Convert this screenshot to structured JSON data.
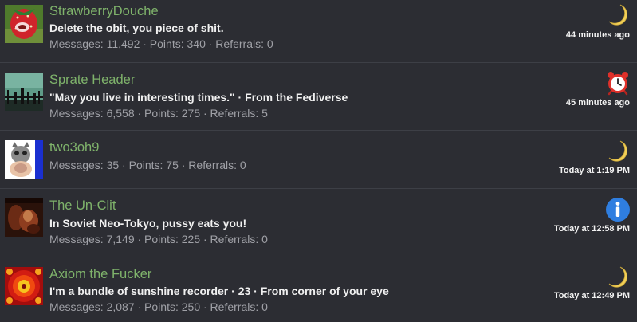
{
  "members": [
    {
      "name": "StrawberryDouche",
      "status": "Delete the obit, you piece of shit.",
      "stats": "Messages: 11,492 · Points: 340 · Referrals: 0",
      "time": "44 minutes ago",
      "icon": "crescent-moon-icon"
    },
    {
      "name": "Sprate Header",
      "status": "\"May you live in interesting times.\" · From the Fediverse",
      "stats": "Messages: 6,558 · Points: 275 · Referrals: 5",
      "time": "45 minutes ago",
      "icon": "alarm-clock-icon"
    },
    {
      "name": "two3oh9",
      "status": "",
      "stats": "Messages: 35 · Points: 75 · Referrals: 0",
      "time": "Today at 1:19 PM",
      "icon": "crescent-moon-icon"
    },
    {
      "name": "The Un-Clit",
      "status": "In Soviet Neo-Tokyo, pussy eats you!",
      "stats": "Messages: 7,149 · Points: 225 · Referrals: 0",
      "time": "Today at 12:58 PM",
      "icon": "info-icon"
    },
    {
      "name": "Axiom the Fucker",
      "status": "I'm a bundle of sunshine recorder · 23 · From corner of your eye",
      "stats": "Messages: 2,087 · Points: 250 · Referrals: 0",
      "time": "Today at 12:49 PM",
      "icon": "crescent-moon-icon"
    }
  ],
  "colors": {
    "background": "#2c2d33",
    "username": "#7fb36b",
    "status_text": "#f0f0f0",
    "stats_text": "#a0a1a7",
    "separator": "#3d3f46",
    "moon": "#f2cf57",
    "info_blue": "#2f7ee0",
    "alarm_red": "#e0302a"
  }
}
